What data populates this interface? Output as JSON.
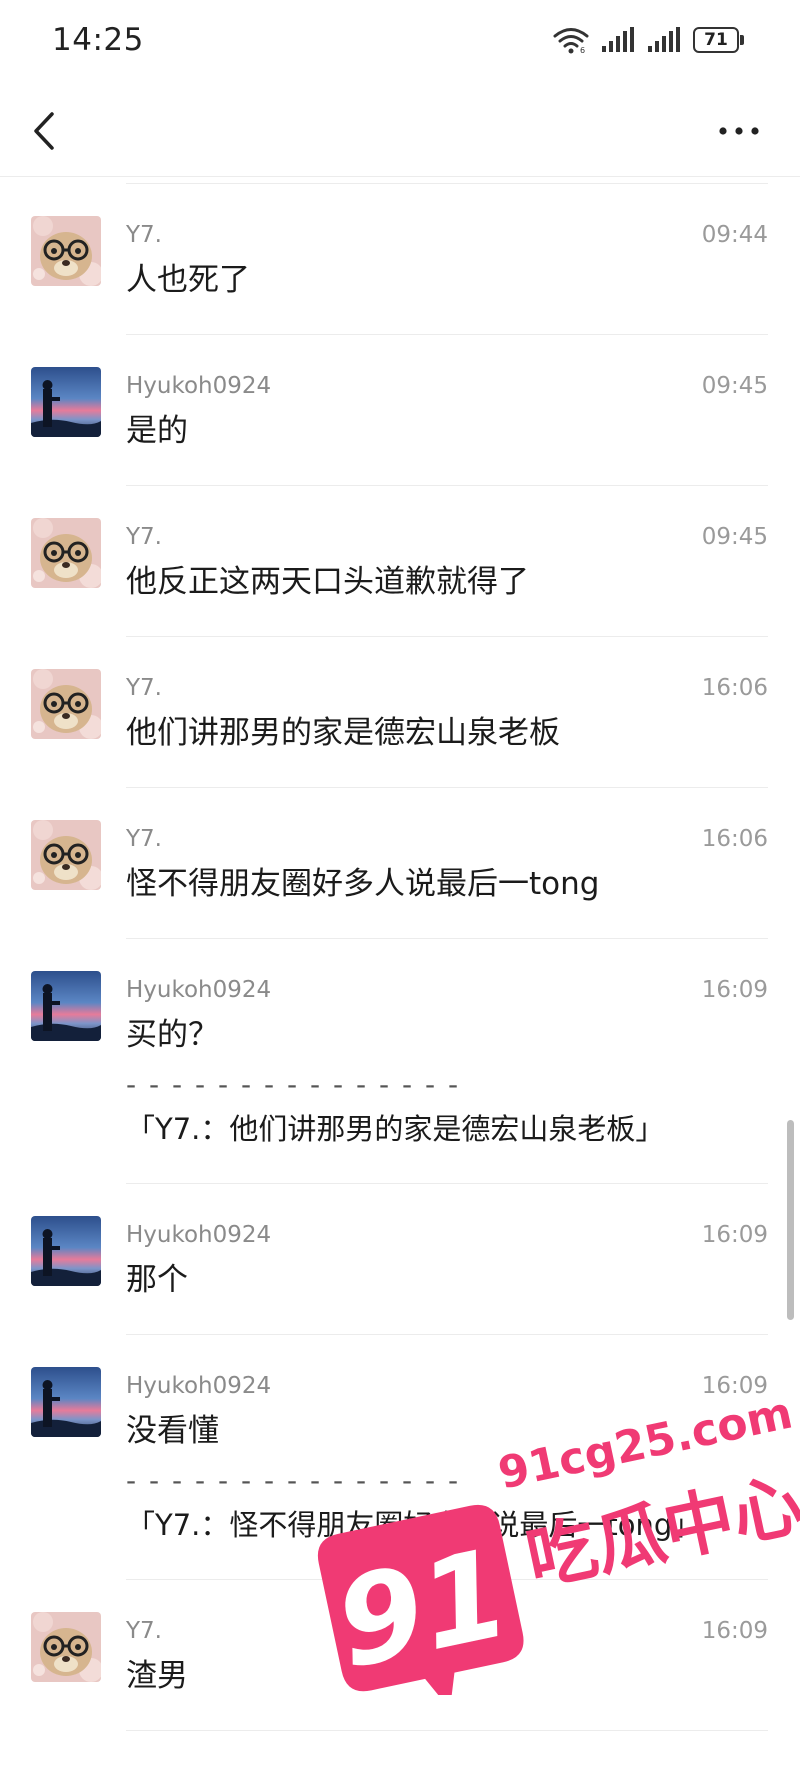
{
  "status_bar": {
    "time": "14:25",
    "battery": "71"
  },
  "messages": [
    {
      "author": "Y7.",
      "avatar": "bear",
      "time": "09:44",
      "text": "人也死了"
    },
    {
      "author": "Hyukoh0924",
      "avatar": "sunset",
      "time": "09:45",
      "text": "是的"
    },
    {
      "author": "Y7.",
      "avatar": "bear",
      "time": "09:45",
      "text": "他反正这两天口头道歉就得了"
    },
    {
      "author": "Y7.",
      "avatar": "bear",
      "time": "16:06",
      "text": "他们讲那男的家是德宏山泉老板"
    },
    {
      "author": "Y7.",
      "avatar": "bear",
      "time": "16:06",
      "text": "怪不得朋友圈好多人说最后一tong"
    },
    {
      "author": "Hyukoh0924",
      "avatar": "sunset",
      "time": "16:09",
      "text": "买的？",
      "quote_sep": "- - - - - - - - - - - - - - -",
      "quote": "「Y7.：他们讲那男的家是德宏山泉老板」"
    },
    {
      "author": "Hyukoh0924",
      "avatar": "sunset",
      "time": "16:09",
      "text": "那个"
    },
    {
      "author": "Hyukoh0924",
      "avatar": "sunset",
      "time": "16:09",
      "text": "没看懂",
      "quote_sep": "- - - - - - - - - - - - - - -",
      "quote": "「Y7.：怪不得朋友圈好多人说最后一tong」"
    },
    {
      "author": "Y7.",
      "avatar": "bear",
      "time": "16:09",
      "text": "渣男"
    }
  ],
  "watermark": {
    "site": "91cg25.com",
    "number": "91",
    "name": "吃瓜中心"
  }
}
